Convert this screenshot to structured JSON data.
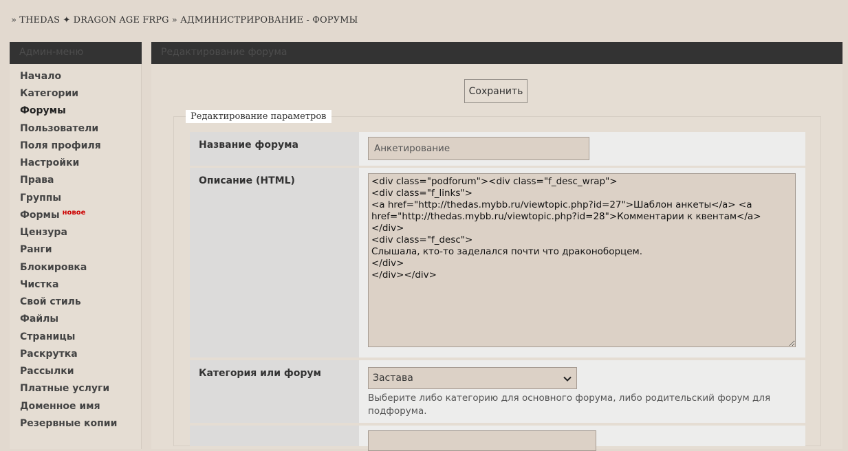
{
  "breadcrumb": {
    "prefix": "»",
    "site": "THEDAS ✦ DRAGON AGE FRPG",
    "separator": "»",
    "section": "АДМИНИСТРИРОВАНИЕ - ФОРУМЫ"
  },
  "sidebar": {
    "title": "Админ-меню",
    "badge_new": "новое",
    "items": [
      {
        "label": "Начало"
      },
      {
        "label": "Категории"
      },
      {
        "label": "Форумы"
      },
      {
        "label": "Пользователи"
      },
      {
        "label": "Поля профиля"
      },
      {
        "label": "Настройки"
      },
      {
        "label": "Права"
      },
      {
        "label": "Группы"
      },
      {
        "label": "Формы"
      },
      {
        "label": "Цензура"
      },
      {
        "label": "Ранги"
      },
      {
        "label": "Блокировка"
      },
      {
        "label": "Чистка"
      },
      {
        "label": "Свой стиль"
      },
      {
        "label": "Файлы"
      },
      {
        "label": "Страницы"
      },
      {
        "label": "Раскрутка"
      },
      {
        "label": "Рассылки"
      },
      {
        "label": "Платные услуги"
      },
      {
        "label": "Доменное имя"
      },
      {
        "label": "Резервные копии"
      }
    ]
  },
  "main": {
    "title": "Редактирование форума",
    "save_label": "Сохранить",
    "legend": "Редактирование параметров",
    "fields": {
      "name": {
        "label": "Название форума",
        "value": "Анкетирование"
      },
      "description": {
        "label": "Описание (HTML)",
        "value": "<div class=\"podforum\"><div class=\"f_desc_wrap\">\n<div class=\"f_links\">\n<a href=\"http://thedas.mybb.ru/viewtopic.php?id=27\">Шаблон анкеты</a> <a href=\"http://thedas.mybb.ru/viewtopic.php?id=28\">Комментарии к квентам</a>\n</div>\n<div class=\"f_desc\">\nСлышала, кто-то заделался почти что драконоборцем.\n</div>\n</div></div>"
      },
      "parent": {
        "label": "Категория или форум",
        "selected": "Застава",
        "hint": "Выберите либо категорию для основного форума, либо родительский форум для подфорума."
      }
    }
  },
  "colors": {
    "page_bg": "#e2d9cf",
    "header_bg": "#333333",
    "badge_red": "#cc0000"
  }
}
